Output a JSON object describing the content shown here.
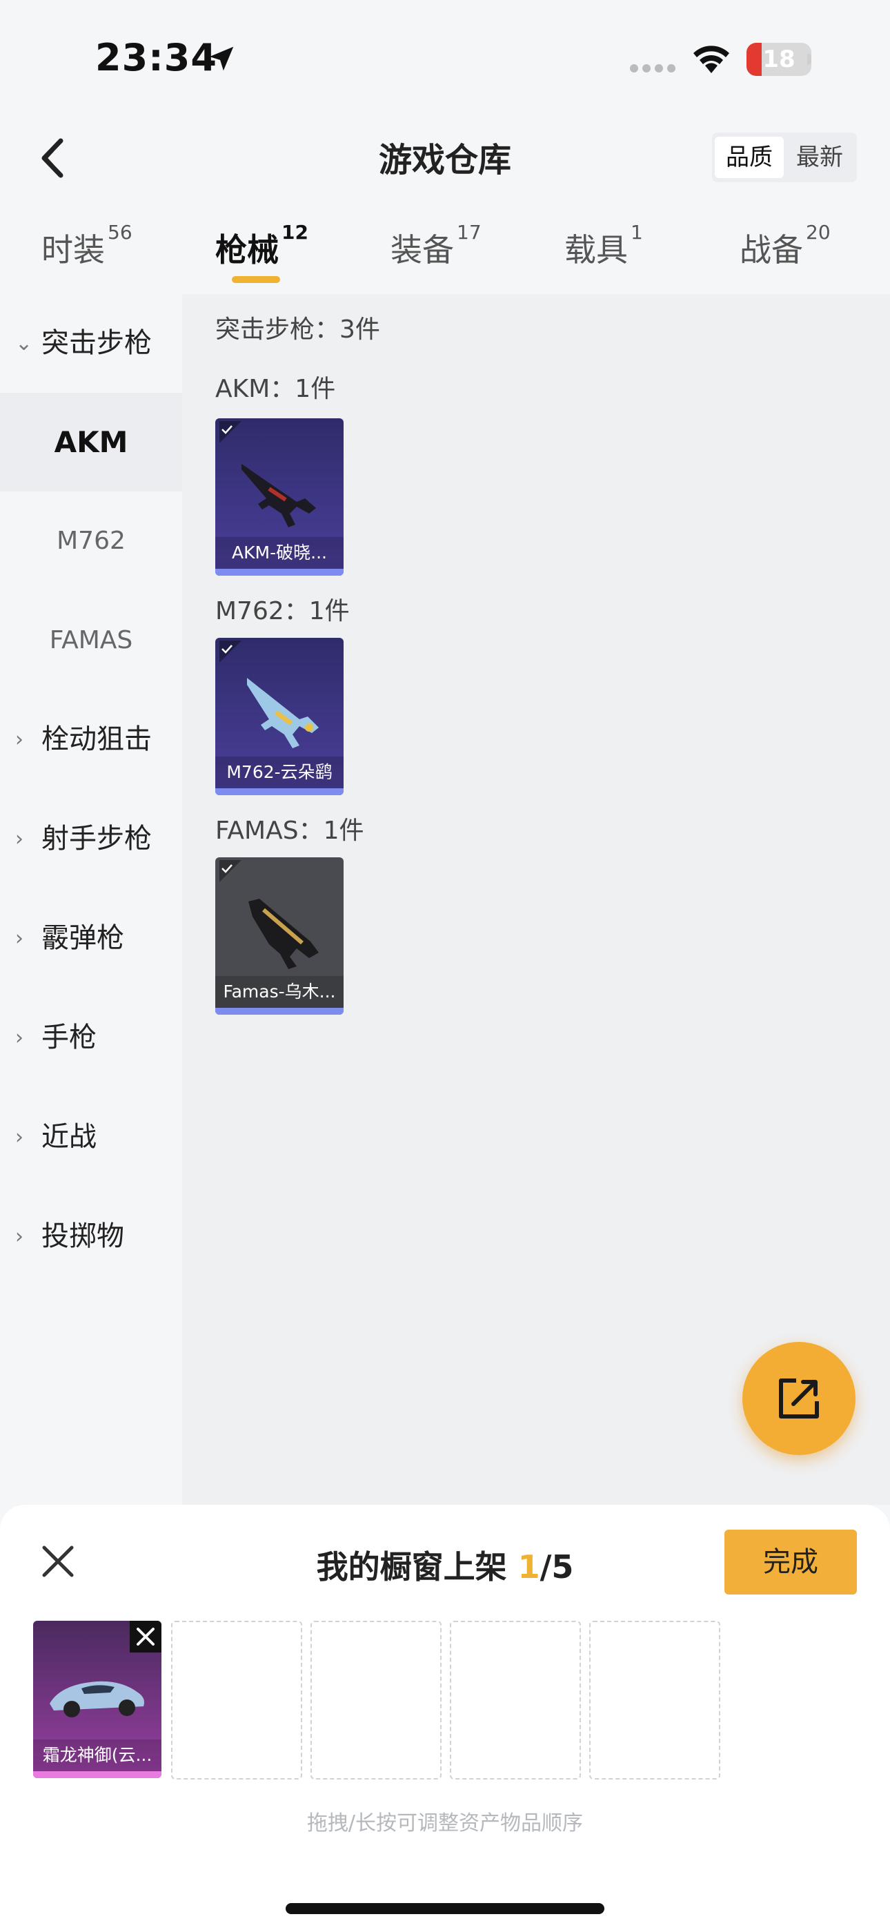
{
  "status_bar": {
    "time": "23:34",
    "battery": "18"
  },
  "header": {
    "title": "游戏仓库",
    "sort_options": [
      "品质",
      "最新"
    ],
    "sort_active": "品质"
  },
  "tabs": [
    {
      "label": "时装",
      "count": "56"
    },
    {
      "label": "枪械",
      "count": "12",
      "active": true
    },
    {
      "label": "装备",
      "count": "17"
    },
    {
      "label": "载具",
      "count": "1"
    },
    {
      "label": "战备",
      "count": "20"
    }
  ],
  "sidebar": {
    "groups": [
      {
        "label": "突击步枪",
        "expanded": true,
        "subs": [
          "AKM",
          "M762",
          "FAMAS"
        ]
      },
      {
        "label": "栓动狙击"
      },
      {
        "label": "射手步枪"
      },
      {
        "label": "霰弹枪"
      },
      {
        "label": "手枪"
      },
      {
        "label": "近战"
      },
      {
        "label": "投掷物"
      }
    ],
    "active_sub": "AKM"
  },
  "content": {
    "summary": "突击步枪：3件",
    "sections": [
      {
        "label": "AKM：1件",
        "item": {
          "name": "AKM-破晓...",
          "bg": "purple"
        }
      },
      {
        "label": "M762：1件",
        "item": {
          "name": "M762-云朵鹞",
          "bg": "purple"
        }
      },
      {
        "label": "FAMAS：1件",
        "item": {
          "name": "Famas-乌木...",
          "bg": "gray"
        }
      }
    ]
  },
  "showcase": {
    "title": "我的橱窗上架",
    "count": "1",
    "total": "/5",
    "done_label": "完成",
    "filled_item": {
      "name": "霜龙神御(云..."
    },
    "hint": "拖拽/长按可调整资产物品顺序"
  },
  "colors": {
    "accent": "#f0b232",
    "rarity_purple": "#7e8cf0",
    "rarity_pink": "#e77be0"
  }
}
